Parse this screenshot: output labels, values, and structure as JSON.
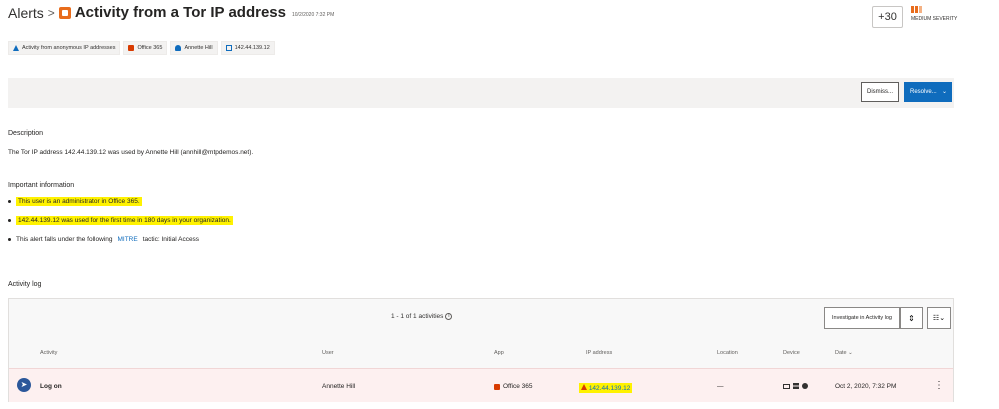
{
  "header": {
    "breadcrumb": "Alerts",
    "separator": ">",
    "title": "Activity from a Tor IP address",
    "timestamp": "10/2/2020 7:32 PM",
    "score": "+30",
    "severity": "MEDIUM SEVERITY",
    "accent_color": "#e86c1c"
  },
  "tags": [
    {
      "label": "Activity from anonymous IP addresses",
      "icon": "anonymous-icon"
    },
    {
      "label": "Office 365",
      "icon": "office-icon"
    },
    {
      "label": "Annette Hill",
      "icon": "user-icon"
    },
    {
      "label": "142.44.139.12",
      "icon": "external-link-icon"
    }
  ],
  "actions": {
    "dismiss": "Dismiss...",
    "resolve": "Resolve...",
    "resolve_color": "#0f6cbd"
  },
  "description": {
    "title": "Description",
    "text": "The Tor IP address 142.44.139.12 was used by Annette Hill (annhill@mtpdemos.net)."
  },
  "important": {
    "title": "Important information",
    "item1": "This user is an administrator in Office 365.",
    "item2": "142.44.139.12 was used for the first time in 180 days in your organization.",
    "item3_prefix": "This alert falls under the following",
    "item3_link": "MITRE",
    "item3_suffix": "tactic: Initial Access",
    "highlight_color": "#fff200"
  },
  "activity_log": {
    "title": "Activity log",
    "count": "1 - 1 of 1 activities",
    "investigate_button": "Investigate in Activity log",
    "columns": {
      "activity": "Activity",
      "user": "User",
      "app": "App",
      "ip": "IP address",
      "location": "Location",
      "device": "Device",
      "date": "Date"
    },
    "row": {
      "activity": "Log on",
      "user": "Annette Hill",
      "app": "Office 365",
      "ip": "142.44.139.12",
      "location": "—",
      "date": "Oct 2, 2020, 7:32 PM"
    }
  }
}
